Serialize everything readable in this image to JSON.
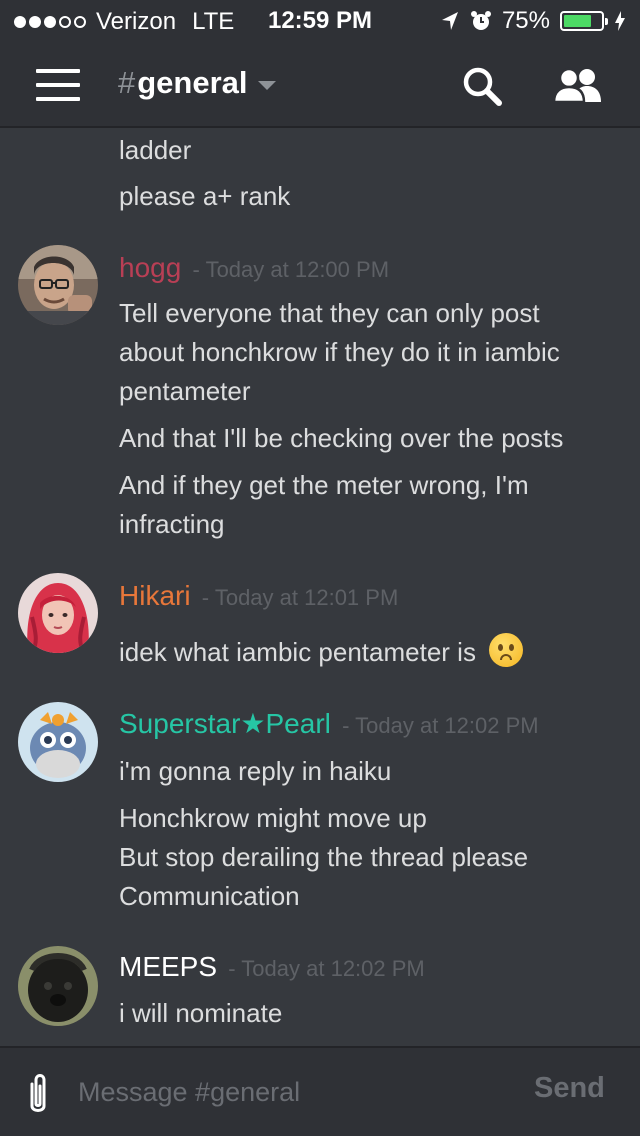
{
  "status_bar": {
    "carrier": "Verizon",
    "network": "LTE",
    "time": "12:59 PM",
    "battery_percent_label": "75%",
    "battery_level": 0.75,
    "signal_bars_filled": 3,
    "signal_bars_total": 5
  },
  "header": {
    "channel_hash": "#",
    "channel_name": "general",
    "icons": [
      "hamburger-icon",
      "search-icon",
      "members-icon"
    ]
  },
  "messages": {
    "continued_lines": [
      "ladder",
      "please a+ rank"
    ],
    "groups": [
      {
        "author": "hogg",
        "author_color": "#b93f55",
        "timestamp": "- Today at 12:00 PM",
        "lines": [
          "Tell everyone that they can only post",
          "about honchkrow if they do it in iambic",
          "pentameter",
          "And that I'll be checking over the posts",
          "And if they get the meter wrong, I'm",
          "infracting"
        ]
      },
      {
        "author": "Hikari",
        "author_color": "#e8773a",
        "timestamp": "- Today at 12:01 PM",
        "lines": [
          "idek what iambic pentameter is"
        ],
        "emoji": "frowning-face-emoji"
      },
      {
        "author": "Superstar★Pearl",
        "author_color": "#26c6a5",
        "timestamp": "- Today at 12:02 PM",
        "lines": [
          "i'm gonna reply in haiku",
          "Honchkrow might move up",
          "But stop derailing the thread please",
          "Communication"
        ]
      },
      {
        "author": "MEEPS",
        "author_color": "#ffffff",
        "timestamp": "- Today at 12:02 PM",
        "lines": [
          "i will nominate"
        ]
      }
    ]
  },
  "composer": {
    "placeholder": "Message #general",
    "send_label": "Send"
  },
  "colors": {
    "background": "#36393e",
    "header": "#2f3136",
    "text": "#dcddde",
    "timestamp": "#5e6166"
  }
}
